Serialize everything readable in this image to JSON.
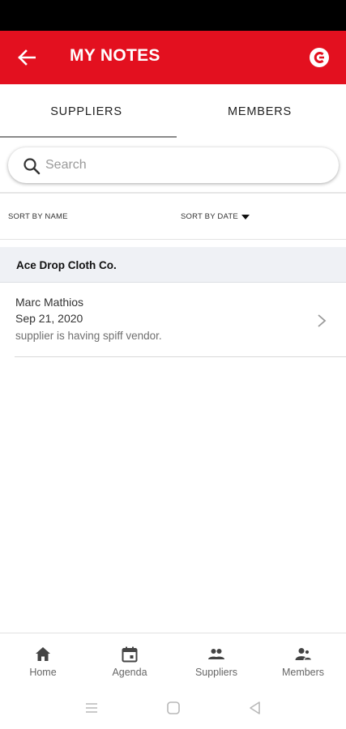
{
  "app_bar": {
    "title": "MY NOTES",
    "back_icon": "arrow-left-icon",
    "brand_icon": "brand-logo-icon",
    "background": "#e3101f"
  },
  "tabs": [
    {
      "label": "SUPPLIERS",
      "selected": true
    },
    {
      "label": "MEMBERS",
      "selected": false
    }
  ],
  "search": {
    "placeholder": "Search",
    "value": "",
    "icon": "search-icon"
  },
  "sort": {
    "by_name_label": "SORT BY NAME",
    "by_date_label": "SORT BY DATE",
    "date_direction": "descending"
  },
  "groups": [
    {
      "title": "Ace Drop Cloth Co.",
      "notes": [
        {
          "author": "Marc Mathios",
          "date": "Sep 21, 2020",
          "text": "supplier is having spiff vendor."
        }
      ]
    }
  ],
  "bottom_nav": [
    {
      "label": "Home",
      "icon": "home-icon"
    },
    {
      "label": "Agenda",
      "icon": "calendar-icon"
    },
    {
      "label": "Suppliers",
      "icon": "people-icon"
    },
    {
      "label": "Members",
      "icon": "members-icon"
    }
  ],
  "system_nav": [
    {
      "icon": "recents-icon"
    },
    {
      "icon": "home-circle-icon"
    },
    {
      "icon": "back-triangle-icon"
    }
  ]
}
